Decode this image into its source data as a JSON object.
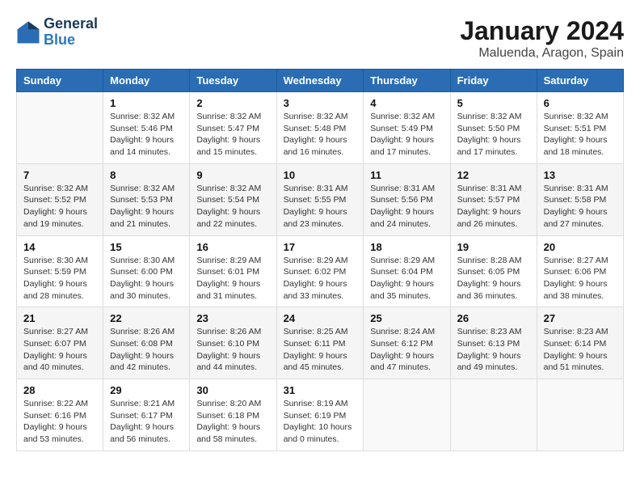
{
  "header": {
    "logo_general": "General",
    "logo_blue": "Blue",
    "month_year": "January 2024",
    "location": "Maluenda, Aragon, Spain"
  },
  "columns": [
    "Sunday",
    "Monday",
    "Tuesday",
    "Wednesday",
    "Thursday",
    "Friday",
    "Saturday"
  ],
  "weeks": [
    [
      {
        "day": "",
        "sunrise": "",
        "sunset": "",
        "daylight": "",
        "empty": true
      },
      {
        "day": "1",
        "sunrise": "Sunrise: 8:32 AM",
        "sunset": "Sunset: 5:46 PM",
        "daylight": "Daylight: 9 hours and 14 minutes."
      },
      {
        "day": "2",
        "sunrise": "Sunrise: 8:32 AM",
        "sunset": "Sunset: 5:47 PM",
        "daylight": "Daylight: 9 hours and 15 minutes."
      },
      {
        "day": "3",
        "sunrise": "Sunrise: 8:32 AM",
        "sunset": "Sunset: 5:48 PM",
        "daylight": "Daylight: 9 hours and 16 minutes."
      },
      {
        "day": "4",
        "sunrise": "Sunrise: 8:32 AM",
        "sunset": "Sunset: 5:49 PM",
        "daylight": "Daylight: 9 hours and 17 minutes."
      },
      {
        "day": "5",
        "sunrise": "Sunrise: 8:32 AM",
        "sunset": "Sunset: 5:50 PM",
        "daylight": "Daylight: 9 hours and 17 minutes."
      },
      {
        "day": "6",
        "sunrise": "Sunrise: 8:32 AM",
        "sunset": "Sunset: 5:51 PM",
        "daylight": "Daylight: 9 hours and 18 minutes."
      }
    ],
    [
      {
        "day": "7",
        "sunrise": "Sunrise: 8:32 AM",
        "sunset": "Sunset: 5:52 PM",
        "daylight": "Daylight: 9 hours and 19 minutes."
      },
      {
        "day": "8",
        "sunrise": "Sunrise: 8:32 AM",
        "sunset": "Sunset: 5:53 PM",
        "daylight": "Daylight: 9 hours and 21 minutes."
      },
      {
        "day": "9",
        "sunrise": "Sunrise: 8:32 AM",
        "sunset": "Sunset: 5:54 PM",
        "daylight": "Daylight: 9 hours and 22 minutes."
      },
      {
        "day": "10",
        "sunrise": "Sunrise: 8:31 AM",
        "sunset": "Sunset: 5:55 PM",
        "daylight": "Daylight: 9 hours and 23 minutes."
      },
      {
        "day": "11",
        "sunrise": "Sunrise: 8:31 AM",
        "sunset": "Sunset: 5:56 PM",
        "daylight": "Daylight: 9 hours and 24 minutes."
      },
      {
        "day": "12",
        "sunrise": "Sunrise: 8:31 AM",
        "sunset": "Sunset: 5:57 PM",
        "daylight": "Daylight: 9 hours and 26 minutes."
      },
      {
        "day": "13",
        "sunrise": "Sunrise: 8:31 AM",
        "sunset": "Sunset: 5:58 PM",
        "daylight": "Daylight: 9 hours and 27 minutes."
      }
    ],
    [
      {
        "day": "14",
        "sunrise": "Sunrise: 8:30 AM",
        "sunset": "Sunset: 5:59 PM",
        "daylight": "Daylight: 9 hours and 28 minutes."
      },
      {
        "day": "15",
        "sunrise": "Sunrise: 8:30 AM",
        "sunset": "Sunset: 6:00 PM",
        "daylight": "Daylight: 9 hours and 30 minutes."
      },
      {
        "day": "16",
        "sunrise": "Sunrise: 8:29 AM",
        "sunset": "Sunset: 6:01 PM",
        "daylight": "Daylight: 9 hours and 31 minutes."
      },
      {
        "day": "17",
        "sunrise": "Sunrise: 8:29 AM",
        "sunset": "Sunset: 6:02 PM",
        "daylight": "Daylight: 9 hours and 33 minutes."
      },
      {
        "day": "18",
        "sunrise": "Sunrise: 8:29 AM",
        "sunset": "Sunset: 6:04 PM",
        "daylight": "Daylight: 9 hours and 35 minutes."
      },
      {
        "day": "19",
        "sunrise": "Sunrise: 8:28 AM",
        "sunset": "Sunset: 6:05 PM",
        "daylight": "Daylight: 9 hours and 36 minutes."
      },
      {
        "day": "20",
        "sunrise": "Sunrise: 8:27 AM",
        "sunset": "Sunset: 6:06 PM",
        "daylight": "Daylight: 9 hours and 38 minutes."
      }
    ],
    [
      {
        "day": "21",
        "sunrise": "Sunrise: 8:27 AM",
        "sunset": "Sunset: 6:07 PM",
        "daylight": "Daylight: 9 hours and 40 minutes."
      },
      {
        "day": "22",
        "sunrise": "Sunrise: 8:26 AM",
        "sunset": "Sunset: 6:08 PM",
        "daylight": "Daylight: 9 hours and 42 minutes."
      },
      {
        "day": "23",
        "sunrise": "Sunrise: 8:26 AM",
        "sunset": "Sunset: 6:10 PM",
        "daylight": "Daylight: 9 hours and 44 minutes."
      },
      {
        "day": "24",
        "sunrise": "Sunrise: 8:25 AM",
        "sunset": "Sunset: 6:11 PM",
        "daylight": "Daylight: 9 hours and 45 minutes."
      },
      {
        "day": "25",
        "sunrise": "Sunrise: 8:24 AM",
        "sunset": "Sunset: 6:12 PM",
        "daylight": "Daylight: 9 hours and 47 minutes."
      },
      {
        "day": "26",
        "sunrise": "Sunrise: 8:23 AM",
        "sunset": "Sunset: 6:13 PM",
        "daylight": "Daylight: 9 hours and 49 minutes."
      },
      {
        "day": "27",
        "sunrise": "Sunrise: 8:23 AM",
        "sunset": "Sunset: 6:14 PM",
        "daylight": "Daylight: 9 hours and 51 minutes."
      }
    ],
    [
      {
        "day": "28",
        "sunrise": "Sunrise: 8:22 AM",
        "sunset": "Sunset: 6:16 PM",
        "daylight": "Daylight: 9 hours and 53 minutes."
      },
      {
        "day": "29",
        "sunrise": "Sunrise: 8:21 AM",
        "sunset": "Sunset: 6:17 PM",
        "daylight": "Daylight: 9 hours and 56 minutes."
      },
      {
        "day": "30",
        "sunrise": "Sunrise: 8:20 AM",
        "sunset": "Sunset: 6:18 PM",
        "daylight": "Daylight: 9 hours and 58 minutes."
      },
      {
        "day": "31",
        "sunrise": "Sunrise: 8:19 AM",
        "sunset": "Sunset: 6:19 PM",
        "daylight": "Daylight: 10 hours and 0 minutes."
      },
      {
        "day": "",
        "sunrise": "",
        "sunset": "",
        "daylight": "",
        "empty": true
      },
      {
        "day": "",
        "sunrise": "",
        "sunset": "",
        "daylight": "",
        "empty": true
      },
      {
        "day": "",
        "sunrise": "",
        "sunset": "",
        "daylight": "",
        "empty": true
      }
    ]
  ]
}
